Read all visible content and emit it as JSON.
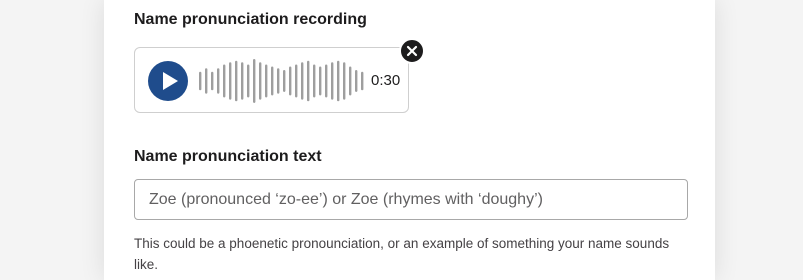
{
  "recording": {
    "label": "Name pronunciation recording",
    "duration": "0:30",
    "play_icon": "play-icon",
    "remove_icon": "close-icon",
    "waveform_levels": [
      0.42,
      0.58,
      0.42,
      0.58,
      0.75,
      0.85,
      0.92,
      0.85,
      0.75,
      1.0,
      0.85,
      0.75,
      0.66,
      0.58,
      0.5,
      0.66,
      0.75,
      0.85,
      0.92,
      0.75,
      0.66,
      0.75,
      0.85,
      0.92,
      0.85,
      0.66,
      0.5,
      0.42
    ]
  },
  "pronunciation_text": {
    "label": "Name pronunciation text",
    "placeholder": "Zoe (pronounced ‘zo-ee’) or Zoe (rhymes with ‘doughy’)",
    "value": "",
    "helper": "This could be a phoenetic pronounciation, or an example of something your name sounds like."
  },
  "colors": {
    "play_button": "#1f4c8c",
    "waveform": "#9e9e9e",
    "remove_button": "#1d1c1d"
  }
}
